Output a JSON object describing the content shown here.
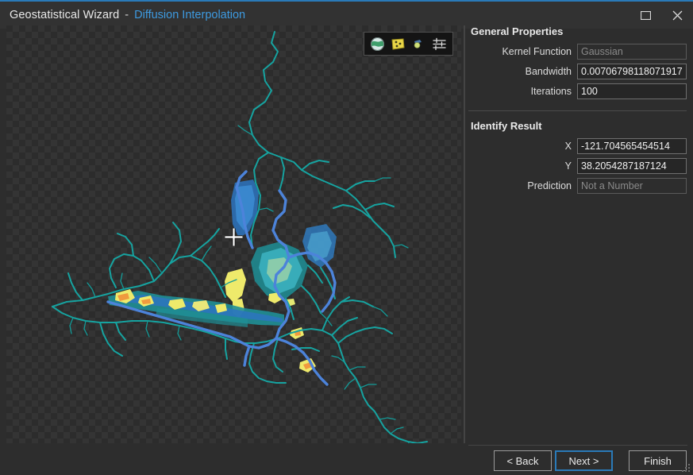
{
  "window": {
    "title": "Geostatistical Wizard",
    "separator": "-",
    "subtitle": "Diffusion Interpolation",
    "restore_icon": "restore-window-icon",
    "close_icon": "close-icon"
  },
  "map": {
    "toolbar": [
      {
        "name": "basemap-globe-icon",
        "title": "Basemap"
      },
      {
        "name": "layers-surface-icon",
        "title": "Surface"
      },
      {
        "name": "sample-points-icon",
        "title": "Points"
      },
      {
        "name": "settings-sliders-icon",
        "title": "Display Options"
      }
    ],
    "cursor": "crosshair-cursor",
    "colors": {
      "background": "#2c2c2c",
      "checker": "#343434",
      "stream_teal": "#16a3a0",
      "stream_blue": "#4c83da",
      "surface_teal": "#1f8f96",
      "surface_cyan": "#3fb6c6",
      "surface_green": "#9fd3a8",
      "surface_yellow": "#eeea6b",
      "surface_orange": "#f09a3e"
    }
  },
  "panel": {
    "general_properties": {
      "title": "General Properties",
      "fields": [
        {
          "label": "Kernel Function",
          "value": "Gaussian",
          "disabled": true
        },
        {
          "label": "Bandwidth",
          "value": "0.00706798118071917",
          "disabled": false
        },
        {
          "label": "Iterations",
          "value": "100",
          "disabled": false
        }
      ]
    },
    "identify_result": {
      "title": "Identify Result",
      "fields": [
        {
          "label": "X",
          "value": "-121.704565454514",
          "disabled": false
        },
        {
          "label": "Y",
          "value": "38.2054287187124",
          "disabled": false
        },
        {
          "label": "Prediction",
          "value": "Not a Number",
          "disabled": true
        }
      ]
    }
  },
  "footer": {
    "back_label": "< Back",
    "next_label": "Next >",
    "finish_label": "Finish"
  }
}
